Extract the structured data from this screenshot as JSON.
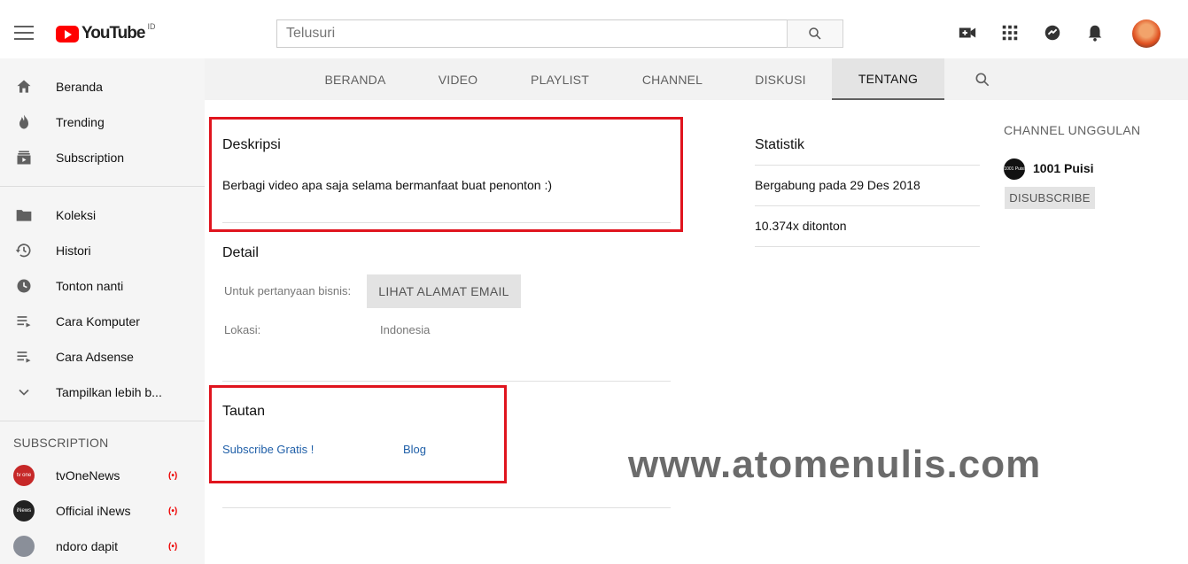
{
  "header": {
    "logo_text": "YouTube",
    "country_code": "ID",
    "search_placeholder": "Telusuri"
  },
  "sidebar": {
    "main_items": [
      {
        "label": "Beranda",
        "icon": "home-icon"
      },
      {
        "label": "Trending",
        "icon": "flame-icon"
      },
      {
        "label": "Subscription",
        "icon": "subscriptions-icon"
      }
    ],
    "library_items": [
      {
        "label": "Koleksi",
        "icon": "folder-icon"
      },
      {
        "label": "Histori",
        "icon": "history-icon"
      },
      {
        "label": "Tonton nanti",
        "icon": "clock-icon"
      },
      {
        "label": "Cara Komputer",
        "icon": "playlist-icon"
      },
      {
        "label": "Cara Adsense",
        "icon": "playlist-icon"
      },
      {
        "label": "Tampilkan lebih b...",
        "icon": "chevron-down-icon"
      }
    ],
    "subscription_header": "SUBSCRIPTION",
    "subscriptions": [
      {
        "label": "tvOneNews",
        "avatar_text": "tv one",
        "avatar_color": "#c62828"
      },
      {
        "label": "Official iNews",
        "avatar_text": "iNews",
        "avatar_color": "#222222"
      },
      {
        "label": "ndoro dapit",
        "avatar_text": "",
        "avatar_color": "#8a8f99"
      }
    ],
    "live_symbol": "(•)"
  },
  "tabs": [
    {
      "label": "BERANDA"
    },
    {
      "label": "VIDEO"
    },
    {
      "label": "PLAYLIST"
    },
    {
      "label": "CHANNEL"
    },
    {
      "label": "DISKUSI"
    },
    {
      "label": "TENTANG",
      "active": true
    }
  ],
  "about": {
    "description_title": "Deskripsi",
    "description_text": "Berbagi video apa saja selama bermanfaat buat penonton :)",
    "detail_title": "Detail",
    "business_label": "Untuk pertanyaan bisnis:",
    "email_button": "LIHAT ALAMAT EMAIL",
    "location_label": "Lokasi:",
    "location_value": "Indonesia",
    "links_title": "Tautan",
    "links": [
      {
        "label": "Subscribe Gratis !"
      },
      {
        "label": "Blog"
      }
    ]
  },
  "stats": {
    "title": "Statistik",
    "joined": "Bergabung pada 29 Des 2018",
    "views": "10.374x ditonton"
  },
  "featured": {
    "title": "CHANNEL UNGGULAN",
    "channel_name": "1001 Puisi",
    "avatar_text": "1001 Puisi",
    "button": "DISUBSCRIBE"
  },
  "watermark": "www.atomenulis.com",
  "colors": {
    "accent_red": "#e0141e",
    "brand_red": "#ff0000",
    "link_blue": "#1f5fa8"
  }
}
